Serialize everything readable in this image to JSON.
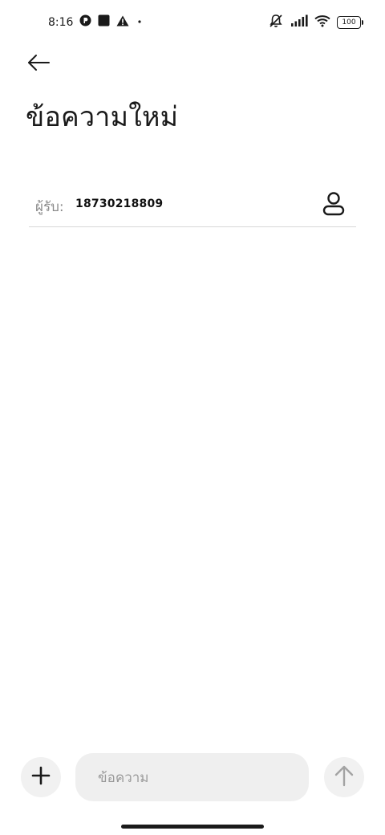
{
  "status_bar": {
    "time": "8:16",
    "battery_level": "100",
    "left_icons": [
      "circle-p-notification-icon",
      "square-notification-icon",
      "warning-icon",
      "dot-icon"
    ],
    "right_icons": [
      "mute-icon",
      "signal-icon",
      "wifi-icon",
      "battery-icon"
    ]
  },
  "header": {
    "back_icon": "back-arrow-icon",
    "title": "ข้อความใหม่"
  },
  "recipient": {
    "label": "ผู้รับ:",
    "value": "18730218809",
    "contact_icon": "contact-person-icon"
  },
  "compose": {
    "add_icon": "plus-icon",
    "placeholder": "ข้อความ",
    "send_icon": "arrow-up-icon"
  }
}
